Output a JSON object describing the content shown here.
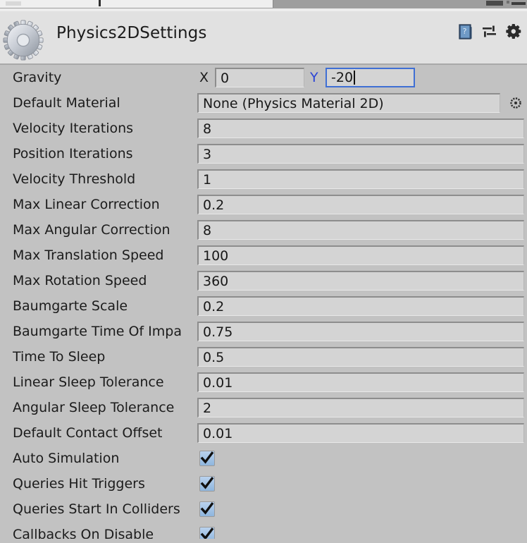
{
  "window": {
    "tabstrip_present": true
  },
  "header": {
    "title": "Physics2DSettings",
    "logo_icon": "gear-icon",
    "icons": [
      {
        "name": "help-book-icon",
        "label": "?"
      },
      {
        "name": "preset-sliders-icon",
        "label": ""
      },
      {
        "name": "settings-gear-icon",
        "label": ""
      }
    ]
  },
  "inspector": {
    "gravity": {
      "label": "Gravity",
      "x_axis_label": "X",
      "y_axis_label": "Y",
      "x_value": "0",
      "y_value": "-20",
      "focused_field": "y",
      "focus_color": "#3f6fd4",
      "y_label_color": "#2b44d6"
    },
    "default_material": {
      "label": "Default Material",
      "value": "None (Physics Material 2D)",
      "picker_icon": "object-picker-icon"
    },
    "number_rows": [
      {
        "label": "Velocity Iterations",
        "value": "8",
        "clipped": false
      },
      {
        "label": "Position Iterations",
        "value": "3",
        "clipped": false
      },
      {
        "label": "Velocity Threshold",
        "value": "1",
        "clipped": false
      },
      {
        "label": "Max Linear Correction",
        "value": "0.2",
        "clipped": false
      },
      {
        "label": "Max Angular Correction",
        "value": "8",
        "clipped": true
      },
      {
        "label": "Max Translation Speed",
        "value": "100",
        "clipped": false
      },
      {
        "label": "Max Rotation Speed",
        "value": "360",
        "clipped": false
      },
      {
        "label": "Baumgarte Scale",
        "value": "0.2",
        "clipped": false
      },
      {
        "label": "Baumgarte Time Of Impa",
        "value": "0.75",
        "clipped": true
      },
      {
        "label": "Time To Sleep",
        "value": "0.5",
        "clipped": false
      },
      {
        "label": "Linear Sleep Tolerance",
        "value": "0.01",
        "clipped": false
      },
      {
        "label": "Angular Sleep Tolerance",
        "value": "2",
        "clipped": true
      },
      {
        "label": "Default Contact Offset",
        "value": "0.01",
        "clipped": false
      }
    ],
    "toggle_rows": [
      {
        "label": "Auto Simulation",
        "checked": true
      },
      {
        "label": "Queries Hit Triggers",
        "checked": true
      },
      {
        "label": "Queries Start In Colliders",
        "checked": true
      },
      {
        "label": "Callbacks On Disable",
        "checked": true
      }
    ]
  },
  "colors": {
    "header_bg": "#e1e1e1",
    "body_bg": "#c2c2c2",
    "field_bg": "#d4d4d4",
    "text": "#1b1b1b",
    "accent_blue": "#3f6fd4",
    "checkbox_top": "#b9d2ee",
    "checkbox_bottom": "#8fb6de"
  }
}
